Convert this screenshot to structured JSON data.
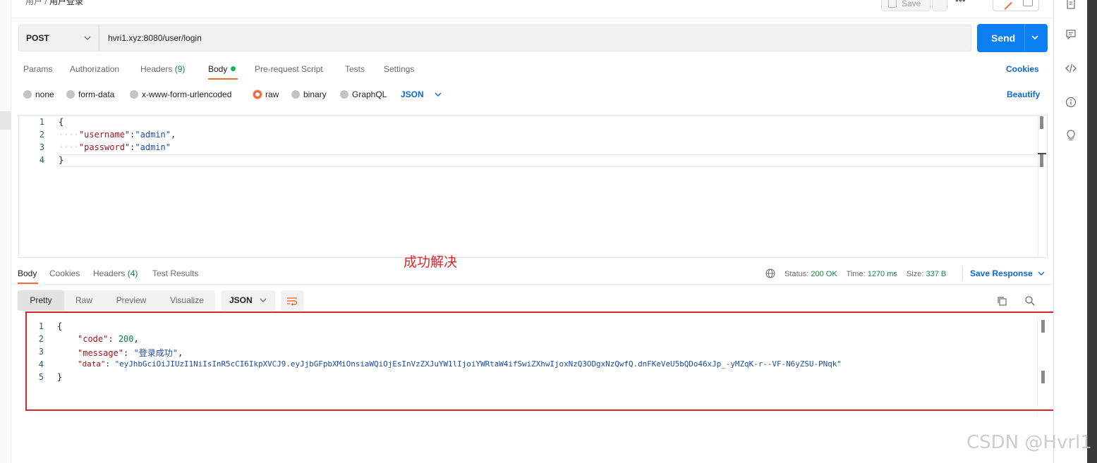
{
  "breadcrumb": {
    "parent": "用户",
    "separator": "/",
    "current": "用户登录"
  },
  "toolbar": {
    "save_label": "Save",
    "more_label": "•••"
  },
  "request": {
    "method": "POST",
    "url": "hvri1.xyz:8080/user/login",
    "send_label": "Send",
    "tabs": {
      "params": "Params",
      "authorization": "Authorization",
      "headers": "Headers",
      "headers_count": "(9)",
      "body": "Body",
      "prerequest": "Pre-request Script",
      "tests": "Tests",
      "settings": "Settings"
    },
    "cookies_label": "Cookies",
    "body_types": {
      "none": "none",
      "form_data": "form-data",
      "urlencoded": "x-www-form-urlencoded",
      "raw": "raw",
      "binary": "binary",
      "graphql": "GraphQL"
    },
    "selected_body_type": "raw",
    "language": "JSON",
    "beautify_label": "Beautify",
    "editor": {
      "line_numbers": [
        "1",
        "2",
        "3",
        "4"
      ],
      "open_brace": "{",
      "indent": "····",
      "username_key": "\"username\"",
      "username_value": "\"admin\"",
      "password_key": "\"password\"",
      "password_value": "\"admin\"",
      "close_brace": "}"
    }
  },
  "annotation": "成功解决",
  "response": {
    "tabs": {
      "body": "Body",
      "cookies": "Cookies",
      "headers": "Headers",
      "headers_count": "(4)",
      "test_results": "Test Results"
    },
    "status_label": "Status:",
    "status_value": "200 OK",
    "time_label": "Time:",
    "time_value": "1270 ms",
    "size_label": "Size:",
    "size_value": "337 B",
    "save_response_label": "Save Response",
    "view_tabs": {
      "pretty": "Pretty",
      "raw": "Raw",
      "preview": "Preview",
      "visualize": "Visualize"
    },
    "format": "JSON",
    "editor": {
      "line_numbers": [
        "1",
        "2",
        "3",
        "4",
        "5"
      ],
      "open_brace": "{",
      "code_key": "\"code\"",
      "code_value": "200",
      "message_key": "\"message\"",
      "message_value": "\"登录成功\"",
      "data_key": "\"data\"",
      "data_value": "\"eyJhbGciOiJIUzI1NiIsInR5cCI6IkpXVCJ9.eyJjbGFpbXMiOnsiaWQiOjEsInVzZXJuYW1lIjoiYWRtaW4ifSwiZXhwIjoxNzQ3ODgxNzQwfQ.dnFKeVeU5bQDo46xJp_-yMZqK-r--VF-N6yZSU-PNqk\"",
      "close_brace": "}"
    }
  },
  "watermark": "CSDN @Hvrl1",
  "colors": {
    "accent_orange": "#f26b3a",
    "send_blue": "#0b7ff2",
    "link_blue": "#0b68d6",
    "status_green": "#0c8a3e",
    "annotation_red": "#e0262b"
  }
}
